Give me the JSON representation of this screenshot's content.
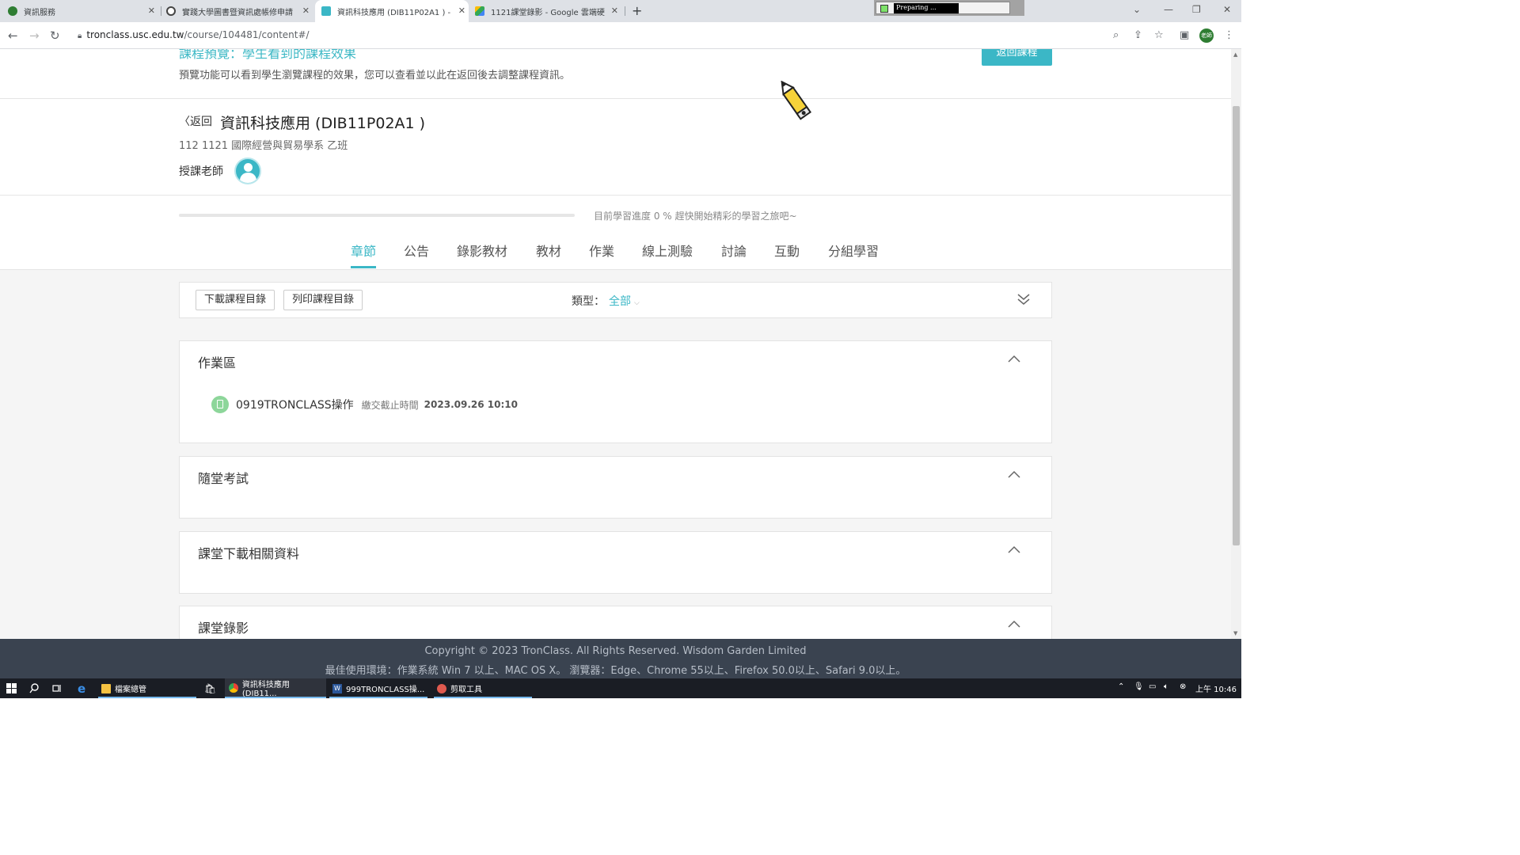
{
  "browser": {
    "tabs": [
      {
        "label": "資訊服務",
        "icon": "globe-green-icon"
      },
      {
        "label": "實踐大學圖書暨資訊處帳修申請",
        "icon": "globe-icon"
      },
      {
        "label": "資訊科技應用 (DIB11P02A1 ) - ",
        "icon": "tronclass-icon"
      },
      {
        "label": "1121課堂錄影 - Google 雲端硬",
        "icon": "google-drive-icon"
      }
    ],
    "preparing_text": "Preparing ...",
    "url_host": "tronclass.usc.edu.tw",
    "url_path": "/course/104481/content#/",
    "profile_label": "老師"
  },
  "preview": {
    "title": "課程預覽：學生看到的課程效果",
    "description": "預覽功能可以看到學生瀏覽課程的效果，您可以查看並以此在返回後去調整課程資訊。",
    "back_button": "返回課程"
  },
  "course": {
    "back_label": "返回",
    "title": "資訊科技應用 (DIB11P02A1 )",
    "subtitle": "112 1121 國際經營與貿易學系 乙班",
    "teacher_label": "授課老師"
  },
  "progress": {
    "percent": 0,
    "text": "目前學習進度 0 % 趕快開始精彩的學習之旅吧~"
  },
  "nav_tabs": [
    "章節",
    "公告",
    "錄影教材",
    "教材",
    "作業",
    "線上測驗",
    "討論",
    "互動",
    "分組學習"
  ],
  "toolbar": {
    "download_label": "下載課程目錄",
    "print_label": "列印課程目錄",
    "type_label": "類型：",
    "type_value": "全部"
  },
  "sections": [
    {
      "title": "作業區",
      "activities": [
        {
          "title": "0919TRONCLASS操作",
          "due_label": "繳交截止時間",
          "due": "2023.09.26 10:10"
        }
      ]
    },
    {
      "title": "隨堂考試",
      "activities": []
    },
    {
      "title": "課堂下載相關資料",
      "activities": []
    },
    {
      "title": "課堂錄影",
      "activities": []
    }
  ],
  "footer": {
    "copyright": "Copyright © 2023 TronClass. All Rights Reserved. Wisdom Garden Limited",
    "env": "最佳使用環境：作業系統 Win 7 以上、MAC OS X。 瀏覽器：Edge、Chrome 55以上、Firefox 50.0以上、Safari 9.0以上。"
  },
  "taskbar": {
    "items": [
      {
        "label": "檔案總管"
      },
      {
        "label": "資訊科技應用 (DIB11..."
      },
      {
        "label": "999TRONCLASS操..."
      },
      {
        "label": "剪取工具"
      }
    ],
    "clock": "上午 10:46"
  },
  "colors": {
    "accent": "#3bb7c6",
    "footer_bg": "#3a4350",
    "taskbar_bg": "#1a1d24"
  }
}
